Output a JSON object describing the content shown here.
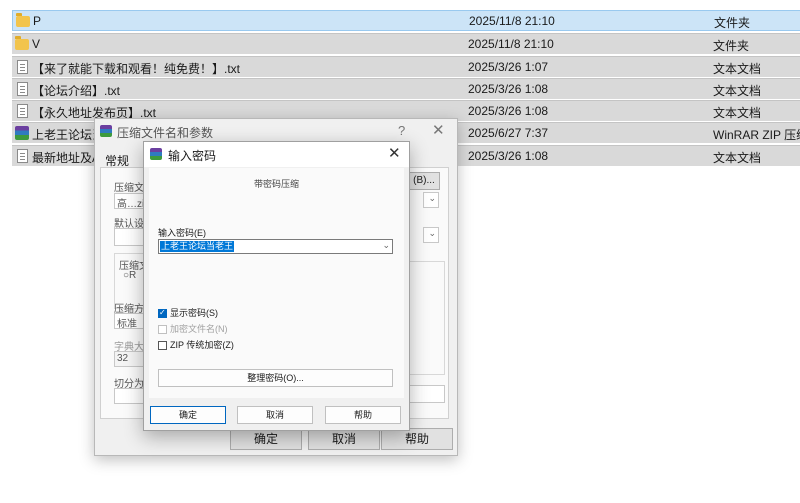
{
  "files": [
    {
      "name": "P",
      "date": "2025/11/8 21:10",
      "type": "文件夹",
      "icon": "folder-icon",
      "selected": true
    },
    {
      "name": "V",
      "date": "2025/11/8 21:10",
      "type": "文件夹",
      "icon": "folder-icon"
    },
    {
      "name": "【来了就能下载和观看！纯免费！】.txt",
      "date": "2025/3/26 1:07",
      "type": "文本文档",
      "icon": "text-file-icon"
    },
    {
      "name": "【论坛介绍】.txt",
      "date": "2025/3/26 1:08",
      "type": "文本文档",
      "icon": "text-file-icon"
    },
    {
      "name": "【永久地址发布页】.txt",
      "date": "2025/3/26 1:08",
      "type": "文本文档",
      "icon": "text-file-icon"
    },
    {
      "name": "上老王论坛当",
      "date": "2025/6/27 7:37",
      "type": "WinRAR ZIP 压缩文件",
      "icon": "winrar-archive-icon"
    },
    {
      "name": "最新地址及AP",
      "date": "2025/3/26 1:08",
      "type": "文本文档",
      "icon": "text-file-icon"
    }
  ],
  "archive_dialog": {
    "title": "压缩文件名和参数",
    "help": "?",
    "close": "✕",
    "tab": "常规",
    "labels": {
      "archive_name": "压缩文件",
      "archive_value": "高…zip",
      "browse": "(B)...",
      "default": "默认设置",
      "format": "压缩文",
      "format_opt": "R",
      "method": "压缩方式",
      "method_value": "标准",
      "dict": "字典大小",
      "dict_value": "32",
      "split": "切分为分"
    },
    "buttons": {
      "ok": "确定",
      "cancel": "取消",
      "help": "帮助"
    }
  },
  "password_dialog": {
    "title": "输入密码",
    "close": "✕",
    "hint": "带密码压缩",
    "password_label": "输入密码(E)",
    "password_value": "上老王论坛当老王",
    "show_password": "显示密码(S)",
    "encrypt_names": "加密文件名(N)",
    "zip_legacy": "ZIP 传统加密(Z)",
    "organize": "整理密码(O)...",
    "buttons": {
      "ok": "确定",
      "cancel": "取消",
      "help": "帮助"
    }
  },
  "colors": {
    "selection": "#cce4f7",
    "accent": "#0067c0"
  }
}
